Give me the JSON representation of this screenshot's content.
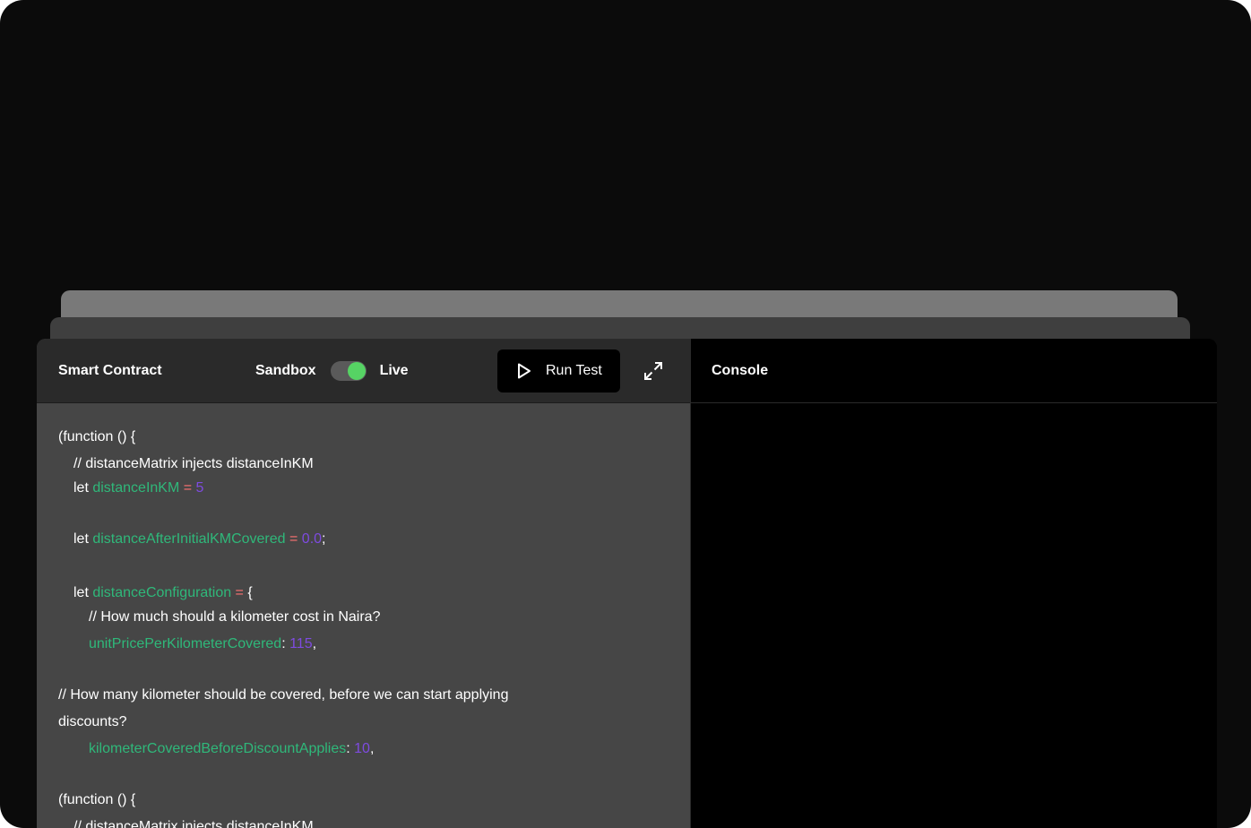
{
  "colors": {
    "variable": "#2fb87a",
    "number": "#7e4be0",
    "operator": "#ff7272",
    "toggle_on": "#56d364"
  },
  "editor": {
    "title": "Smart Contract",
    "mode": {
      "left_label": "Sandbox",
      "right_label": "Live",
      "active": "Live"
    },
    "run_button_label": "Run Test",
    "icons": {
      "run": "play-icon",
      "expand": "expand-icon"
    }
  },
  "code": {
    "l1": "(function () {",
    "l2": "// distanceMatrix injects distanceInKM",
    "l3": {
      "kw": "let ",
      "var": "distanceInKM",
      "op": " = ",
      "num": "5"
    },
    "l4": {
      "kw": "let ",
      "var": "distanceAfterInitialKMCovered",
      "op": " = ",
      "num": "0.0",
      "tail": ";"
    },
    "l5": {
      "kw": "let ",
      "var": "distanceConfiguration",
      "op": " = ",
      "tail": "{"
    },
    "l6": "// How much should a kilometer cost in Naira?",
    "l7": {
      "var": "unitPricePerKilometerCovered",
      "sep": ": ",
      "num": "115",
      "tail": ","
    },
    "l8": "// How many kilometer should be covered, before we can start applying",
    "l9": "discounts?",
    "l10": {
      "var": "kilometerCoveredBeforeDiscountApplies",
      "sep": ": ",
      "num": "10",
      "tail": ","
    },
    "l11": "(function () {",
    "l12": "// distanceMatrix injects distanceInKM"
  },
  "console": {
    "title": "Console"
  }
}
